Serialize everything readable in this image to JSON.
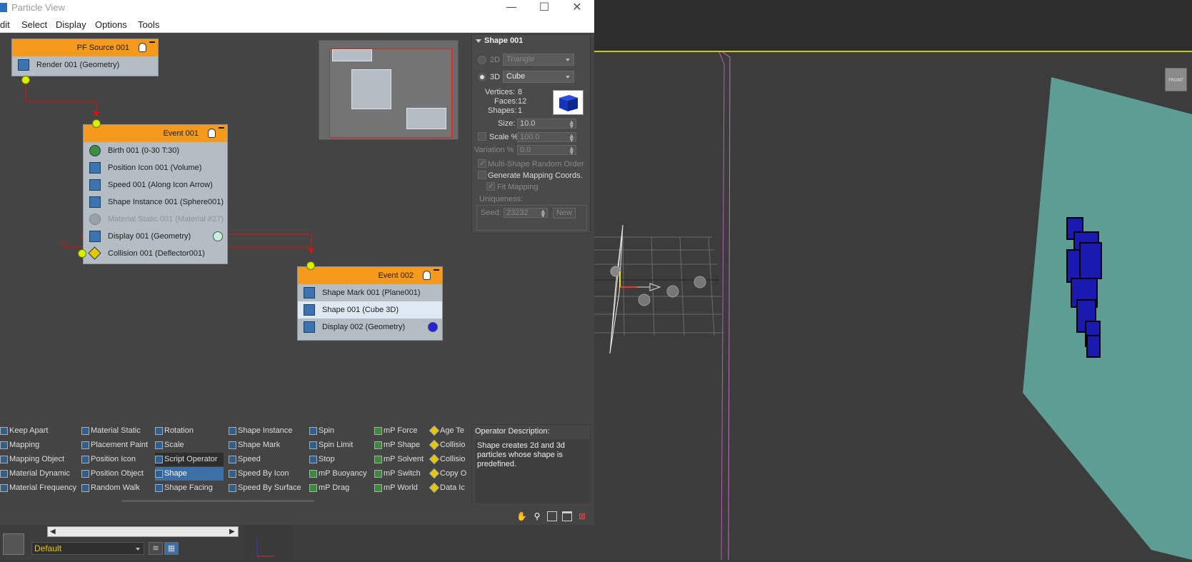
{
  "window": {
    "title": "Particle View",
    "buttons": {
      "minimize": "—",
      "maximize": "☐",
      "close": "✕"
    }
  },
  "menu": [
    "dit",
    "Select",
    "Display",
    "Options",
    "Tools"
  ],
  "graph": {
    "pf_source": {
      "title": "PF Source 001",
      "rows": [
        "Render 001 (Geometry)"
      ]
    },
    "event1": {
      "title": "Event 001",
      "rows": [
        "Birth 001 (0-30 T:30)",
        "Position Icon 001 (Volume)",
        "Speed 001 (Along Icon Arrow)",
        "Shape Instance 001 (Sphere001)",
        "Material Static 001 (Material #27)",
        "Display 001 (Geometry)",
        "Collision 001 (Deflector001)"
      ]
    },
    "event2": {
      "title": "Event 002",
      "rows": [
        "Shape Mark 001 (Plane001)",
        "Shape 001 (Cube 3D)",
        "Display 002 (Geometry)"
      ]
    },
    "colors": {
      "header": "#f59a1c",
      "display1_swatch": "#c8f0dc",
      "display2_swatch": "#2222dd",
      "port": "#d8f000",
      "wire": "#dd1111"
    }
  },
  "depot": {
    "col1": [
      "Keep Apart",
      "Mapping",
      "Mapping Object",
      "Material Dynamic",
      "Material Frequency"
    ],
    "col2": [
      "Material Static",
      "Placement Paint",
      "Position Icon",
      "Position Object",
      "Random Walk"
    ],
    "col3": [
      "Rotation",
      "Scale",
      "Script Operator",
      "Shape",
      "Shape Facing"
    ],
    "col4": [
      "Shape Instance",
      "Shape Mark",
      "Speed",
      "Speed By Icon",
      "Speed By Surface"
    ],
    "col5": [
      "Spin",
      "Spin Limit",
      "Stop",
      "mP Buoyancy",
      "mP Drag"
    ],
    "col6": [
      "mP Force",
      "mP Shape",
      "mP Solvent",
      "mP Switch",
      "mP World"
    ],
    "col7": [
      "Age Te",
      "Collisio",
      "Collisio",
      "Copy O",
      "Data Ic"
    ],
    "selected": "Shape"
  },
  "panel": {
    "title": "Shape 001",
    "label_2d": "2D",
    "value_2d": "Triangle",
    "label_3d": "3D",
    "value_3d": "Cube",
    "vertices_label": "Vertices:",
    "vertices": "8",
    "faces_label": "Faces:",
    "faces": "12",
    "shapes_label": "Shapes:",
    "shapes": "1",
    "size_label": "Size:",
    "size": "10.0",
    "scale_label": "Scale %",
    "scale": "100.0",
    "variation_label": "Variation %",
    "variation": "0.0",
    "multi_shape": "Multi-Shape Random Order",
    "gen_mapping": "Generate Mapping Coords.",
    "fit_mapping": "Fit Mapping",
    "uniqueness": "Uniqueness:",
    "seed_label": "Seed:",
    "seed": "23232",
    "new_label": "New",
    "desc_title": "Operator Description:",
    "desc_text": "Shape creates 2d and 3d particles whose shape is predefined."
  },
  "bottom": {
    "layer": "Default",
    "viewcube": "FRONT"
  },
  "icons": [
    "hand-icon",
    "zoom-icon",
    "zoom-region-icon",
    "fit-icon",
    "no-zoom-icon",
    "lightbulb-icon",
    "layers-icon"
  ]
}
